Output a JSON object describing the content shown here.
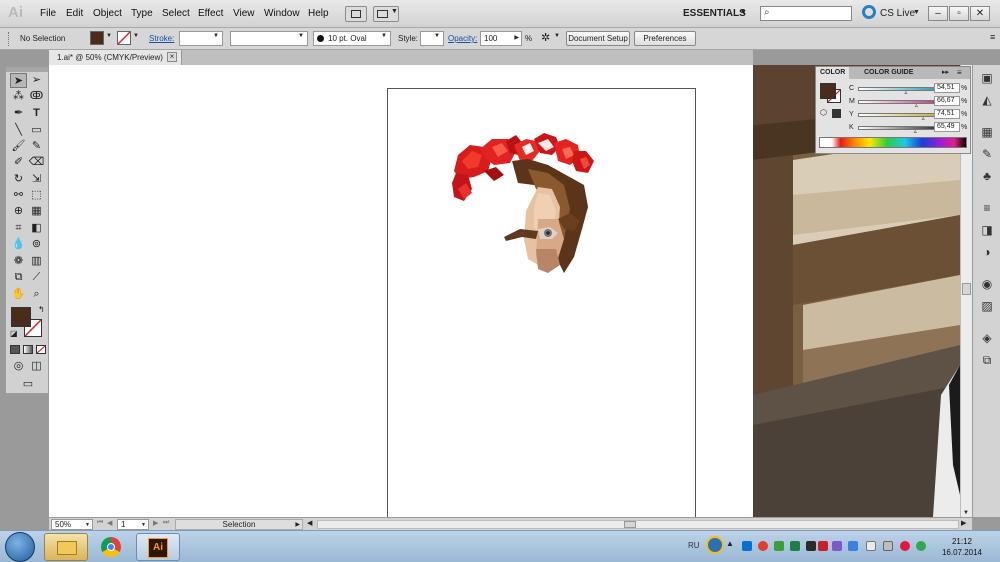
{
  "app": {
    "logo": "Ai"
  },
  "menu": [
    "File",
    "Edit",
    "Object",
    "Type",
    "Select",
    "Effect",
    "View",
    "Window",
    "Help"
  ],
  "workspace": {
    "label": "ESSENTIALS",
    "cs_live": "CS Live"
  },
  "control_bar": {
    "selection_label": "No Selection",
    "stroke_label": "Stroke:",
    "brush_label": "10 pt. Oval",
    "style_label": "Style:",
    "opacity_label": "Opacity:",
    "opacity_value": "100",
    "opacity_unit": "%",
    "document_setup": "Document Setup",
    "preferences": "Preferences",
    "fill_color": "#4a2c1c"
  },
  "document_tab": {
    "title": "1.ai* @ 50% (CMYK/Preview)",
    "close": "×"
  },
  "status_bar": {
    "zoom": "50%",
    "artboard": "1",
    "tool_status": "Selection"
  },
  "color_panel": {
    "tab_color": "COLOR",
    "tab_guide": "COLOR GUIDE",
    "channels": [
      {
        "label": "C",
        "value": "54,51",
        "unit": "%",
        "fraction": 0.5451,
        "color": "#1b8fb6"
      },
      {
        "label": "M",
        "value": "66,67",
        "unit": "%",
        "fraction": 0.6667,
        "color": "#b52a7c"
      },
      {
        "label": "Y",
        "value": "74,51",
        "unit": "%",
        "fraction": 0.7451,
        "color": "#bfa524"
      },
      {
        "label": "K",
        "value": "65,49",
        "unit": "%",
        "fraction": 0.6549,
        "color": "#222222"
      }
    ]
  },
  "taskbar": {
    "language": "RU",
    "time": "21:12",
    "date": "16.07.2014",
    "apps": [
      {
        "name": "file-explorer",
        "icon": "folder-icon"
      },
      {
        "name": "chrome",
        "icon": "chrome-icon"
      },
      {
        "name": "illustrator",
        "icon": "illustrator-icon",
        "label": "Ai"
      }
    ]
  }
}
